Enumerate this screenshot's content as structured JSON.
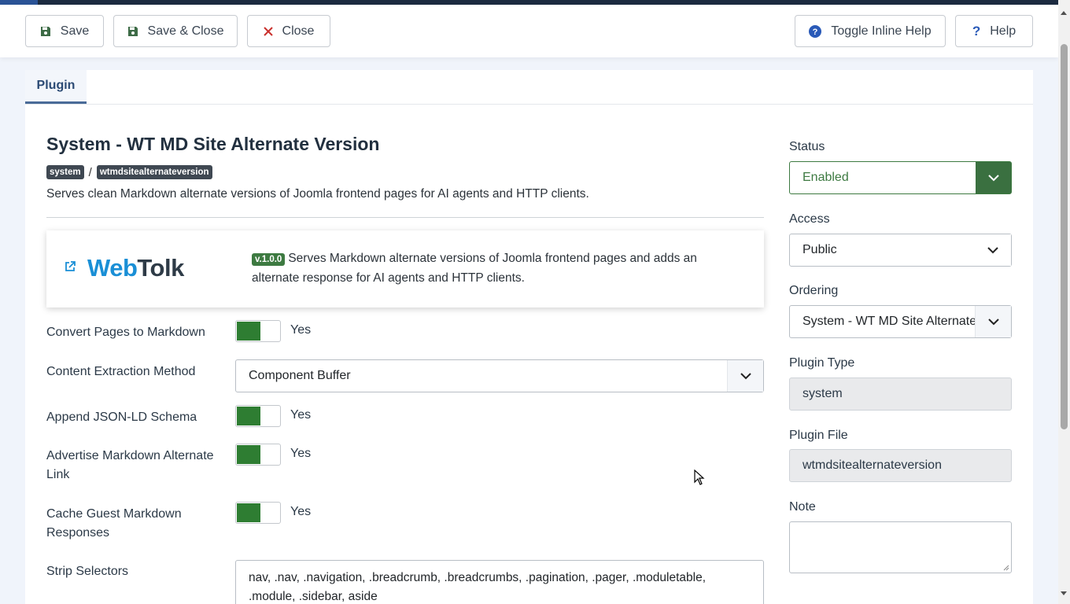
{
  "toolbar": {
    "save": "Save",
    "save_close": "Save & Close",
    "close": "Close",
    "toggle_help": "Toggle Inline Help",
    "help": "Help"
  },
  "tabs": [
    {
      "label": "Plugin",
      "active": true
    }
  ],
  "plugin": {
    "title": "System - WT MD Site Alternate Version",
    "badge_folder": "system",
    "badge_separator": "/",
    "badge_element": "wtmdsitealternateversion",
    "description": "Serves clean Markdown alternate versions of Joomla frontend pages for AI agents and HTTP clients."
  },
  "brand": {
    "logo_part1": "Web",
    "logo_part2": "Tolk",
    "version": "v.1.0.0",
    "text": "Serves Markdown alternate versions of Joomla frontend pages and adds an alternate response for AI agents and HTTP clients."
  },
  "fields": {
    "convert_pages": {
      "label": "Convert Pages to Markdown",
      "value": "Yes"
    },
    "extraction": {
      "label": "Content Extraction Method",
      "value": "Component Buffer"
    },
    "json_ld": {
      "label": "Append JSON-LD Schema",
      "value": "Yes"
    },
    "advertise": {
      "label": "Advertise Markdown Alternate Link",
      "value": "Yes"
    },
    "cache": {
      "label": "Cache Guest Markdown Responses",
      "value": "Yes"
    },
    "strip": {
      "label": "Strip Selectors",
      "value": "nav, .nav, .navigation, .breadcrumb, .breadcrumbs, .pagination, .pager, .moduletable, .module, .sidebar, aside"
    }
  },
  "sidebar": {
    "status_label": "Status",
    "status_value": "Enabled",
    "access_label": "Access",
    "access_value": "Public",
    "ordering_label": "Ordering",
    "ordering_value": "System - WT MD Site Alternate",
    "type_label": "Plugin Type",
    "type_value": "system",
    "file_label": "Plugin File",
    "file_value": "wtmdsitealternateversion",
    "note_label": "Note",
    "note_value": ""
  },
  "colors": {
    "accent_green": "#2e7d32",
    "header_dark": "#1c2b40",
    "brand_blue": "#1a8fd6"
  },
  "icons": [
    "save-icon",
    "close-icon",
    "help-circle-icon",
    "question-icon",
    "external-link-icon",
    "chevron-down-icon"
  ]
}
